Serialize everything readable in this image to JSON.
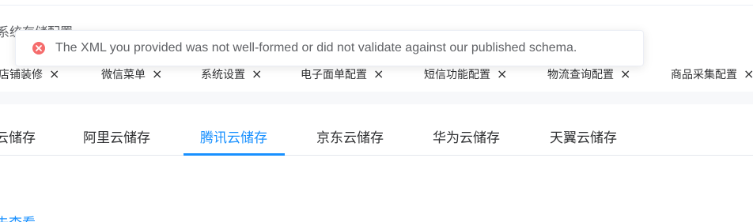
{
  "page": {
    "heading": "系统存储配置"
  },
  "toast": {
    "type": "error",
    "icon": "error-circle-icon",
    "message": "The XML you provided was not well-formed or did not validate against our published schema.",
    "color": "#f56c6c"
  },
  "tags": [
    {
      "label": "店铺装修",
      "close": "×"
    },
    {
      "label": "微信菜单",
      "close": "×"
    },
    {
      "label": "系统设置",
      "close": "×"
    },
    {
      "label": "电子面单配置",
      "close": "×"
    },
    {
      "label": "短信功能配置",
      "close": "×"
    },
    {
      "label": "物流查询配置",
      "close": "×"
    },
    {
      "label": "商品采集配置",
      "close": "×"
    }
  ],
  "tabs": [
    {
      "label": "云储存",
      "active": false
    },
    {
      "label": "阿里云储存",
      "active": false
    },
    {
      "label": "腾讯云储存",
      "active": true
    },
    {
      "label": "京东云储存",
      "active": false
    },
    {
      "label": "华为云储存",
      "active": false
    },
    {
      "label": "天翼云储存",
      "active": false
    }
  ],
  "link": {
    "label": "去查看"
  },
  "colors": {
    "accent": "#1890ff",
    "error": "#f56c6c"
  }
}
